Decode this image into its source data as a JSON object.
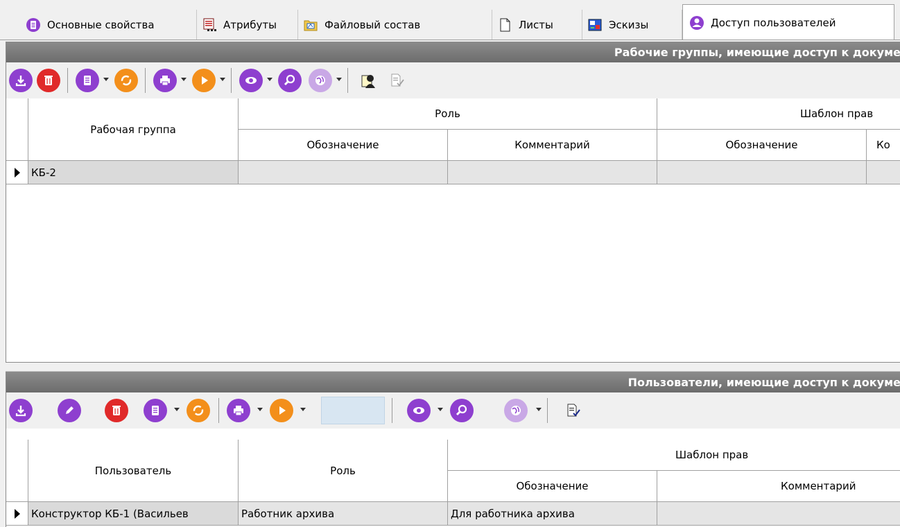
{
  "tabs": [
    {
      "label": "Основные свойства",
      "icon": "properties-icon"
    },
    {
      "label": "Атрибуты",
      "icon": "attributes-icon"
    },
    {
      "label": "Файловый состав",
      "icon": "folder-icon"
    },
    {
      "label": "Листы",
      "icon": "sheet-icon"
    },
    {
      "label": "Эскизы",
      "icon": "sketch-icon"
    },
    {
      "label": "Доступ пользователей",
      "icon": "user-icon",
      "active": true
    }
  ],
  "workgroups": {
    "title": "Рабочие группы, имеющие доступ к докуме",
    "toolbar_icons": [
      "import-icon",
      "delete-icon",
      "document-icon",
      "refresh-icon",
      "print-icon",
      "play-icon",
      "view-icon",
      "search-icon",
      "globe-icon",
      "user-card-icon",
      "approve-icon"
    ],
    "headers": {
      "workgroup": "Рабочая группа",
      "role": "Роль",
      "role_designation": "Обозначение",
      "role_comment": "Комментарий",
      "rights_template": "Шаблон прав",
      "rights_designation": "Обозначение",
      "rights_comment": "Ко"
    },
    "rows": [
      {
        "workgroup": "КБ-2",
        "role_designation": "",
        "role_comment": "",
        "rights_designation": "",
        "rights_comment": ""
      }
    ]
  },
  "users": {
    "title": "Пользователи, имеющие доступ к докуме",
    "toolbar_icons": [
      "import-icon",
      "edit-icon",
      "delete-icon",
      "document-icon",
      "refresh-icon",
      "print-icon",
      "play-icon",
      "view-icon",
      "search-icon",
      "globe-icon",
      "approve-icon"
    ],
    "headers": {
      "user": "Пользователь",
      "role": "Роль",
      "rights_template": "Шаблон прав",
      "rights_designation": "Обозначение",
      "rights_comment": "Комментарий"
    },
    "rows": [
      {
        "user": "Конструктор КБ-1 (Васильев",
        "role": "Работник архива",
        "rights_designation": "Для работника архива",
        "rights_comment": ""
      }
    ]
  },
  "colors": {
    "accent_purple": "#8e3fcf",
    "delete_red": "#e02a2a",
    "action_orange": "#f38f1b",
    "header_gray": "#7a7a7a"
  }
}
